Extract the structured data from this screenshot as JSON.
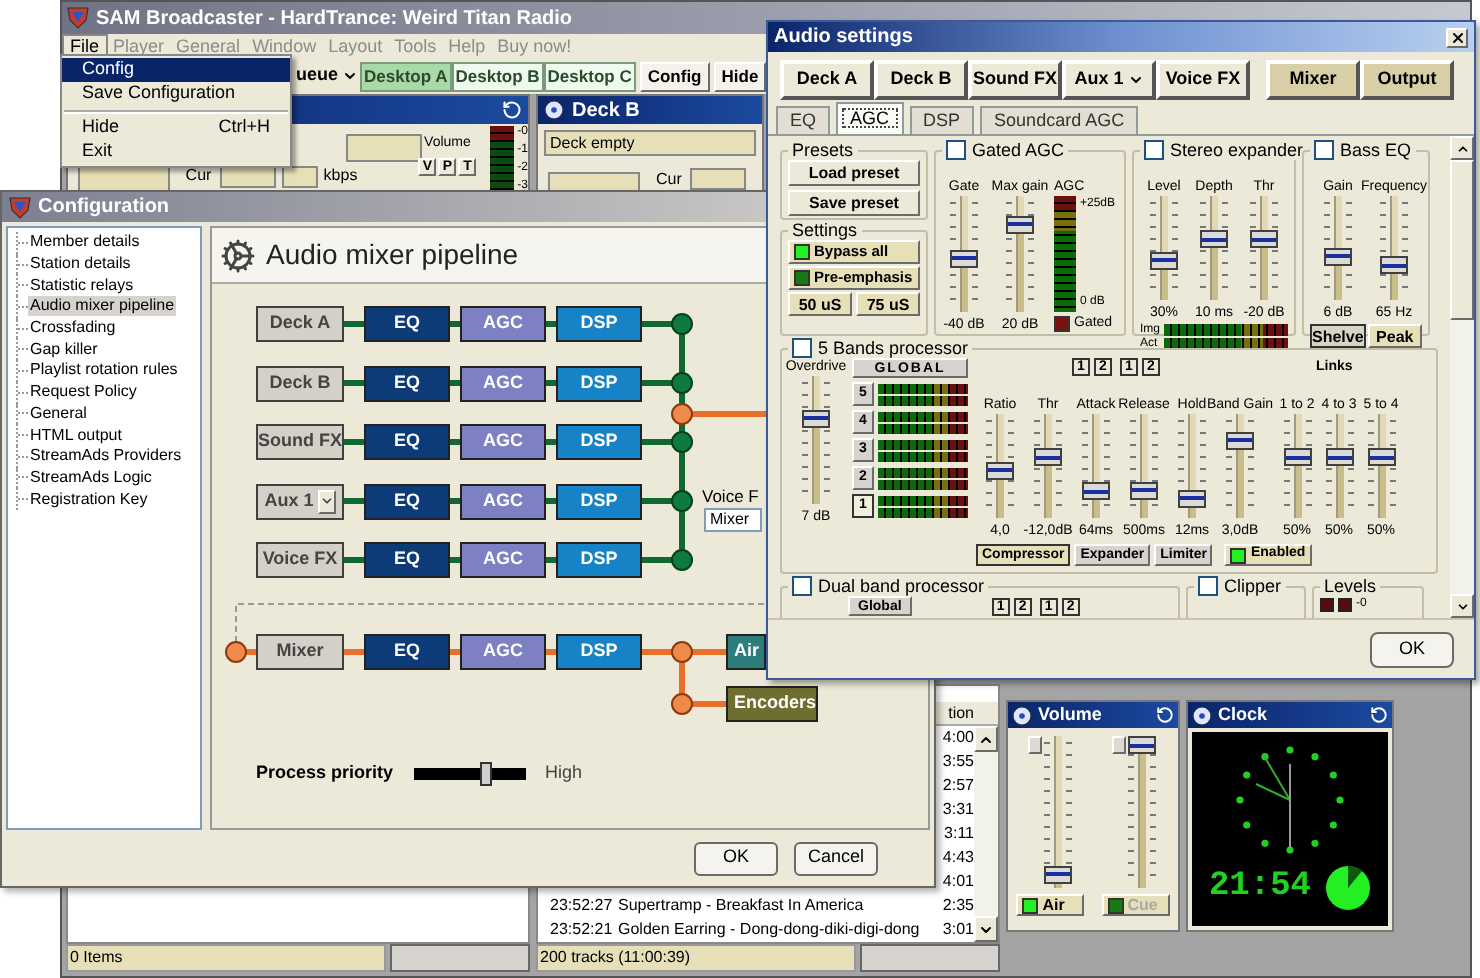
{
  "main_window": {
    "title": "SAM Broadcaster - HardTrance: Weird Titan Radio",
    "menu": [
      {
        "label": "File",
        "open": true
      },
      {
        "label": "Player",
        "open": false
      },
      {
        "label": "General",
        "open": false
      },
      {
        "label": "Window",
        "open": false
      },
      {
        "label": "Layout",
        "open": false
      },
      {
        "label": "Tools",
        "open": false
      },
      {
        "label": "Help",
        "open": false
      },
      {
        "label": "Buy now!",
        "open": false
      }
    ],
    "toolbar": [
      {
        "label": "ueue",
        "kind": "dropdown",
        "selected": false
      },
      {
        "label": "Desktop A",
        "kind": "desktop",
        "selected": true
      },
      {
        "label": "Desktop B",
        "kind": "desktop",
        "selected": false
      },
      {
        "label": "Desktop C",
        "kind": "desktop",
        "selected": false
      },
      {
        "label": "Config",
        "kind": "button",
        "selected": false
      },
      {
        "label": "Hide",
        "kind": "button",
        "selected": false
      }
    ],
    "deck_a": {
      "volume_label": "Volume",
      "volume_buttons": [
        "V",
        "P",
        "T"
      ],
      "meter_labels": [
        "-0",
        "-1",
        "-2",
        "-3"
      ],
      "cur_label": "Cur",
      "rate_unit": "kbps"
    },
    "deck_b": {
      "title": "Deck B",
      "status": "Deck empty",
      "cur_label": "Cur"
    },
    "queue_status": "0 Items",
    "playlist": {
      "column_label": "tion",
      "rows": [
        {
          "duration": "4:00"
        },
        {
          "duration": "3:55"
        },
        {
          "duration": "2:57"
        },
        {
          "duration": "3:31"
        },
        {
          "duration": "3:11"
        },
        {
          "duration": "4:43"
        },
        {
          "duration": "4:01"
        },
        {
          "time": "23:52:27",
          "title": "Supertramp - Breakfast In America",
          "duration": "2:35"
        },
        {
          "time": "23:52:21",
          "title": "Golden Earring - Dong-dong-diki-digi-dong",
          "duration": "3:01"
        }
      ],
      "status": "200 tracks (11:00:39)"
    },
    "volume_panel": {
      "title": "Volume",
      "sliders": [
        {
          "level": 0.03
        },
        {
          "level": 1
        }
      ],
      "buttons": [
        {
          "label": "Air",
          "on": true
        },
        {
          "label": "Cue",
          "on": false
        }
      ]
    },
    "clock_panel": {
      "title": "Clock",
      "time": "21:54"
    }
  },
  "file_menu": [
    {
      "kind": "item",
      "label": "Config",
      "selected": true
    },
    {
      "kind": "item",
      "label": "Save Configuration",
      "selected": false
    },
    {
      "kind": "separator"
    },
    {
      "kind": "item",
      "label": "Hide",
      "shortcut": "Ctrl+H",
      "selected": false
    },
    {
      "kind": "item",
      "label": "Exit",
      "selected": false
    }
  ],
  "configuration": {
    "title": "Configuration",
    "tree": [
      {
        "label": "Member details",
        "selected": false
      },
      {
        "label": "Station details",
        "selected": false
      },
      {
        "label": "Statistic relays",
        "selected": false
      },
      {
        "label": "Audio mixer pipeline",
        "selected": true
      },
      {
        "label": "Crossfading",
        "selected": false
      },
      {
        "label": "Gap killer",
        "selected": false
      },
      {
        "label": "Playlist rotation rules",
        "selected": false
      },
      {
        "label": "Request Policy",
        "selected": false
      },
      {
        "label": "General",
        "selected": false
      },
      {
        "label": "HTML output",
        "selected": false
      },
      {
        "label": "StreamAds Providers",
        "selected": false
      },
      {
        "label": "StreamAds Logic",
        "selected": false
      },
      {
        "label": "Registration Key",
        "selected": false
      }
    ],
    "page_title": "Audio mixer pipeline",
    "channels": [
      {
        "label": "Deck A",
        "kind": "button",
        "stages": [
          "EQ",
          "AGC",
          "DSP"
        ]
      },
      {
        "label": "Deck B",
        "kind": "button",
        "stages": [
          "EQ",
          "AGC",
          "DSP"
        ]
      },
      {
        "label": "Sound FX",
        "kind": "button",
        "stages": [
          "EQ",
          "AGC",
          "DSP"
        ]
      },
      {
        "label": "Aux 1",
        "kind": "dropdown",
        "stages": [
          "EQ",
          "AGC",
          "DSP"
        ]
      },
      {
        "label": "Voice FX",
        "kind": "button",
        "stages": [
          "EQ",
          "AGC",
          "DSP"
        ]
      }
    ],
    "voice_label": "Voice F",
    "voice_select": "Mixer",
    "master": {
      "label": "Mixer",
      "stages": [
        "EQ",
        "AGC",
        "DSP"
      ],
      "outputs": [
        "Air",
        "Encoders"
      ]
    },
    "priority": {
      "label": "Process priority",
      "level": 0.67,
      "reading": "High"
    },
    "buttons": [
      "OK",
      "Cancel"
    ]
  },
  "audio_settings": {
    "title": "Audio settings",
    "sources": [
      {
        "label": "Deck A",
        "kind": "input"
      },
      {
        "label": "Deck B",
        "kind": "input"
      },
      {
        "label": "Sound FX",
        "kind": "input"
      },
      {
        "label": "Aux 1",
        "kind": "dropdown"
      },
      {
        "label": "Voice FX",
        "kind": "input"
      },
      {
        "label": "Mixer",
        "kind": "output"
      },
      {
        "label": "Output",
        "kind": "output"
      }
    ],
    "tabs": [
      {
        "label": "EQ",
        "selected": false
      },
      {
        "label": "AGC",
        "selected": true
      },
      {
        "label": "DSP",
        "selected": false
      },
      {
        "label": "Soundcard AGC",
        "selected": false
      }
    ],
    "presets": {
      "title": "Presets",
      "buttons": [
        "Load preset",
        "Save preset"
      ]
    },
    "settings": {
      "title": "Settings",
      "toggles": [
        {
          "label": "Bypass all",
          "on": true
        },
        {
          "label": "Pre-emphasis",
          "on": false
        }
      ],
      "emphasis": [
        "50 uS",
        "75 uS"
      ]
    },
    "gated_agc": {
      "title": "Gated AGC",
      "checked": false,
      "sliders": [
        {
          "label": "Gate",
          "reading": "-40 dB",
          "level": 0.45
        },
        {
          "label": "Max gain",
          "reading": "20 dB",
          "level": 0.8
        }
      ],
      "meter": {
        "label": "AGC",
        "top": "+25dB",
        "bottom": "0 dB"
      },
      "gated": {
        "label": "Gated",
        "on": false
      }
    },
    "stereo_expander": {
      "title": "Stereo expander",
      "checked": false,
      "sliders": [
        {
          "label": "Level",
          "reading": "30%",
          "level": 0.35
        },
        {
          "label": "Depth",
          "reading": "10 ms",
          "level": 0.6
        },
        {
          "label": "Thr",
          "reading": "-20 dB",
          "level": 0.6
        }
      ],
      "meters": [
        "Img",
        "Act"
      ]
    },
    "bass_eq": {
      "title": "Bass EQ",
      "checked": false,
      "sliders": [
        {
          "label": "Gain",
          "reading": "6 dB",
          "level": 0.4
        },
        {
          "label": "Frequency",
          "reading": "65 Hz",
          "level": 0.3
        }
      ],
      "modes": [
        {
          "label": "Shelve",
          "selected": true
        },
        {
          "label": "Peak",
          "selected": false
        }
      ]
    },
    "five_band": {
      "title": "5 Bands processor",
      "checked": false,
      "overdrive": {
        "label": "Overdrive",
        "reading": "7 dB",
        "level": 0.7
      },
      "global": "GLOBAL",
      "bands": [
        {
          "label": "5",
          "selected": false
        },
        {
          "label": "4",
          "selected": false
        },
        {
          "label": "3",
          "selected": false
        },
        {
          "label": "2",
          "selected": false
        },
        {
          "label": "1",
          "selected": true
        }
      ],
      "pairs": [
        "1",
        "2",
        "1",
        "2"
      ],
      "sliders": [
        {
          "label": "Ratio",
          "reading": "4,0",
          "level": 0.45
        },
        {
          "label": "Thr",
          "reading": "-12,0dB",
          "level": 0.6
        },
        {
          "label": "Attack",
          "reading": "64ms",
          "level": 0.2
        },
        {
          "label": "Release",
          "reading": "500ms",
          "level": 0.22
        },
        {
          "label": "Hold",
          "reading": "12ms",
          "level": 0.12
        },
        {
          "label": "Band Gain",
          "reading": "3,0dB",
          "level": 0.8
        }
      ],
      "links_title": "Links",
      "links": [
        {
          "label": "1 to 2",
          "reading": "50%",
          "level": 0.6
        },
        {
          "label": "4 to 3",
          "reading": "50%",
          "level": 0.6
        },
        {
          "label": "5 to 4",
          "reading": "50%",
          "level": 0.6
        }
      ],
      "modes": [
        {
          "label": "Compressor",
          "selected": true
        },
        {
          "label": "Expander",
          "selected": false
        },
        {
          "label": "Limiter",
          "selected": false
        }
      ],
      "enabled": {
        "label": "Enabled",
        "on": true
      }
    },
    "dual_band": {
      "title": "Dual band processor",
      "checked": false,
      "global": "Global",
      "pairs": [
        "1",
        "2",
        "1",
        "2"
      ]
    },
    "clipper": {
      "title": "Clipper",
      "checked": false
    },
    "levels": {
      "title": "Levels",
      "reading": "-0"
    },
    "ok": "OK"
  }
}
